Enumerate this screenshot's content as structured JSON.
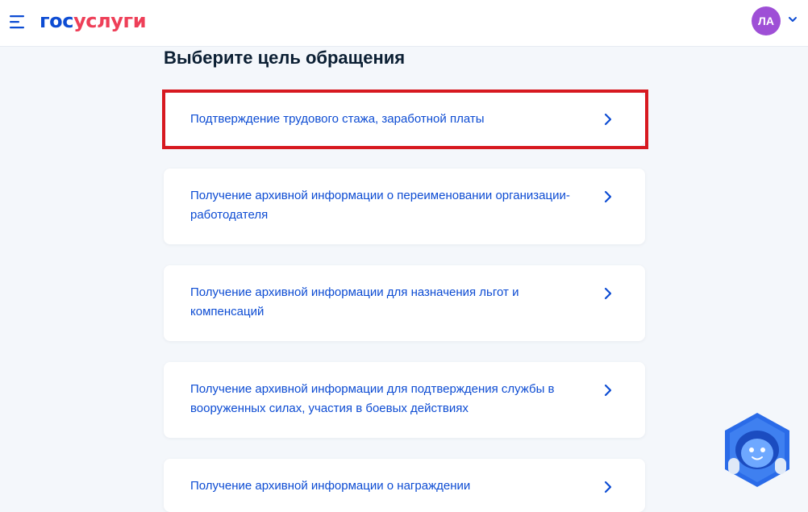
{
  "header": {
    "logo_part1": "гос",
    "logo_part2": "услуги",
    "avatar_initials": "ЛА"
  },
  "main": {
    "title": "Выберите цель обращения",
    "options": [
      {
        "label": "Подтверждение трудового стажа, заработной платы",
        "highlighted": true
      },
      {
        "label": "Получение архивной информации о переименовании организации-работодателя"
      },
      {
        "label": "Получение архивной информации для назначения льгот и компенсаций"
      },
      {
        "label": "Получение архивной информации для подтверждения службы в вооруженных силах, участия в боевых действиях"
      },
      {
        "label": "Получение архивной информации о награждении"
      }
    ]
  },
  "colors": {
    "brand_blue": "#0d4cd3",
    "brand_red": "#ee3f58",
    "highlight_red": "#d71920",
    "avatar_purple": "#9e4fd6",
    "page_bg": "#f4f7fb"
  },
  "icons": {
    "menu": "hamburger-menu-icon",
    "option_arrow": "chevron-right-icon",
    "avatar_arrow": "chevron-down-icon",
    "assistant": "robot-assistant-icon"
  }
}
